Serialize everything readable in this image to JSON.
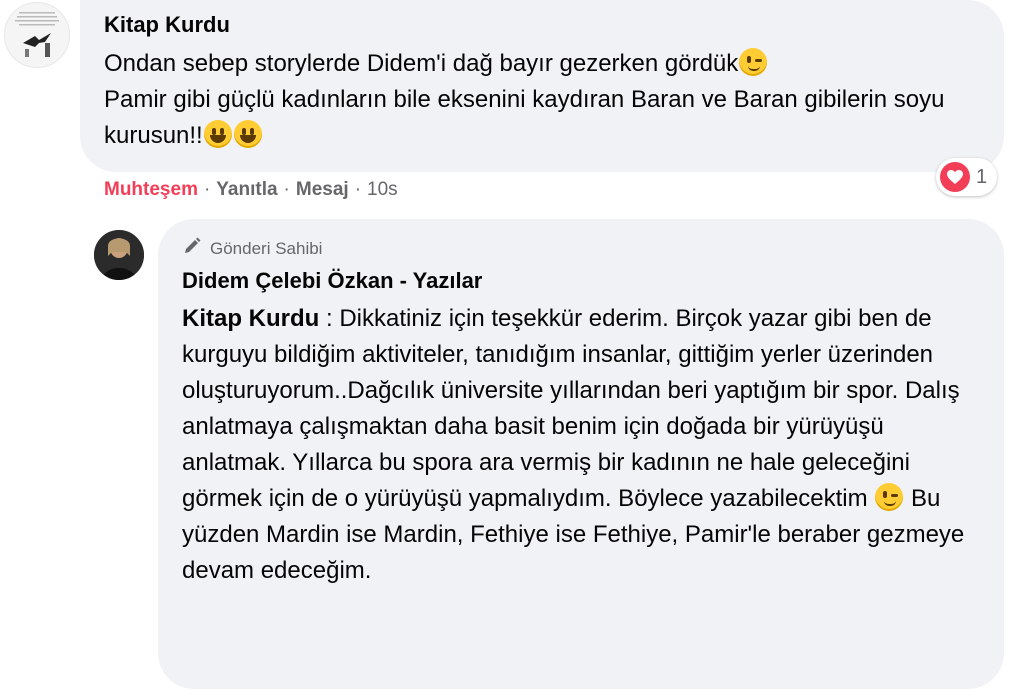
{
  "comment": {
    "author": "Kitap Kurdu",
    "text_line1": "Ondan sebep storylerde Didem'i dağ bayır gezerken gördük",
    "text_line2": "Pamir gibi güçlü kadınların bile eksenini kaydıran Baran ve Baran gibilerin soyu kurusun!!",
    "actions": {
      "reaction_label": "Muhteşem",
      "reply_label": "Yanıtla",
      "message_label": "Mesaj",
      "timestamp": "10s"
    },
    "reaction_count": "1",
    "reaction_icon": "heart-icon"
  },
  "reply": {
    "badge": "Gönderi Sahibi",
    "badge_icon": "pencil-icon",
    "author": "Didem Çelebi Özkan - Yazılar",
    "mention": "Kitap Kurdu",
    "text_part1": " : Dikkatiniz için teşekkür ederim. Birçok yazar gibi ben de kurguyu bildiğim aktiviteler, tanıdığım insanlar, gittiğim yerler üzerinden oluşturuyorum..Dağcılık üniversite yıllarından beri yaptığım bir spor. Dalış anlatmaya çalışmaktan daha basit benim için doğada bir yürüyüşü anlatmak. Yıllarca bu spora ara vermiş bir kadının ne hale geleceğini görmek için de o yürüyüşü yapmalıydım. Böylece yazabilecektim",
    "text_part2": " Bu yüzden Mardin ise Mardin, Fethiye ise Fethiye, Pamir'le beraber gezmeye devam edeceğim."
  },
  "colors": {
    "bubble": "#f0f2f5",
    "reaction_red": "#f33e58",
    "meta_gray": "#65676b"
  }
}
